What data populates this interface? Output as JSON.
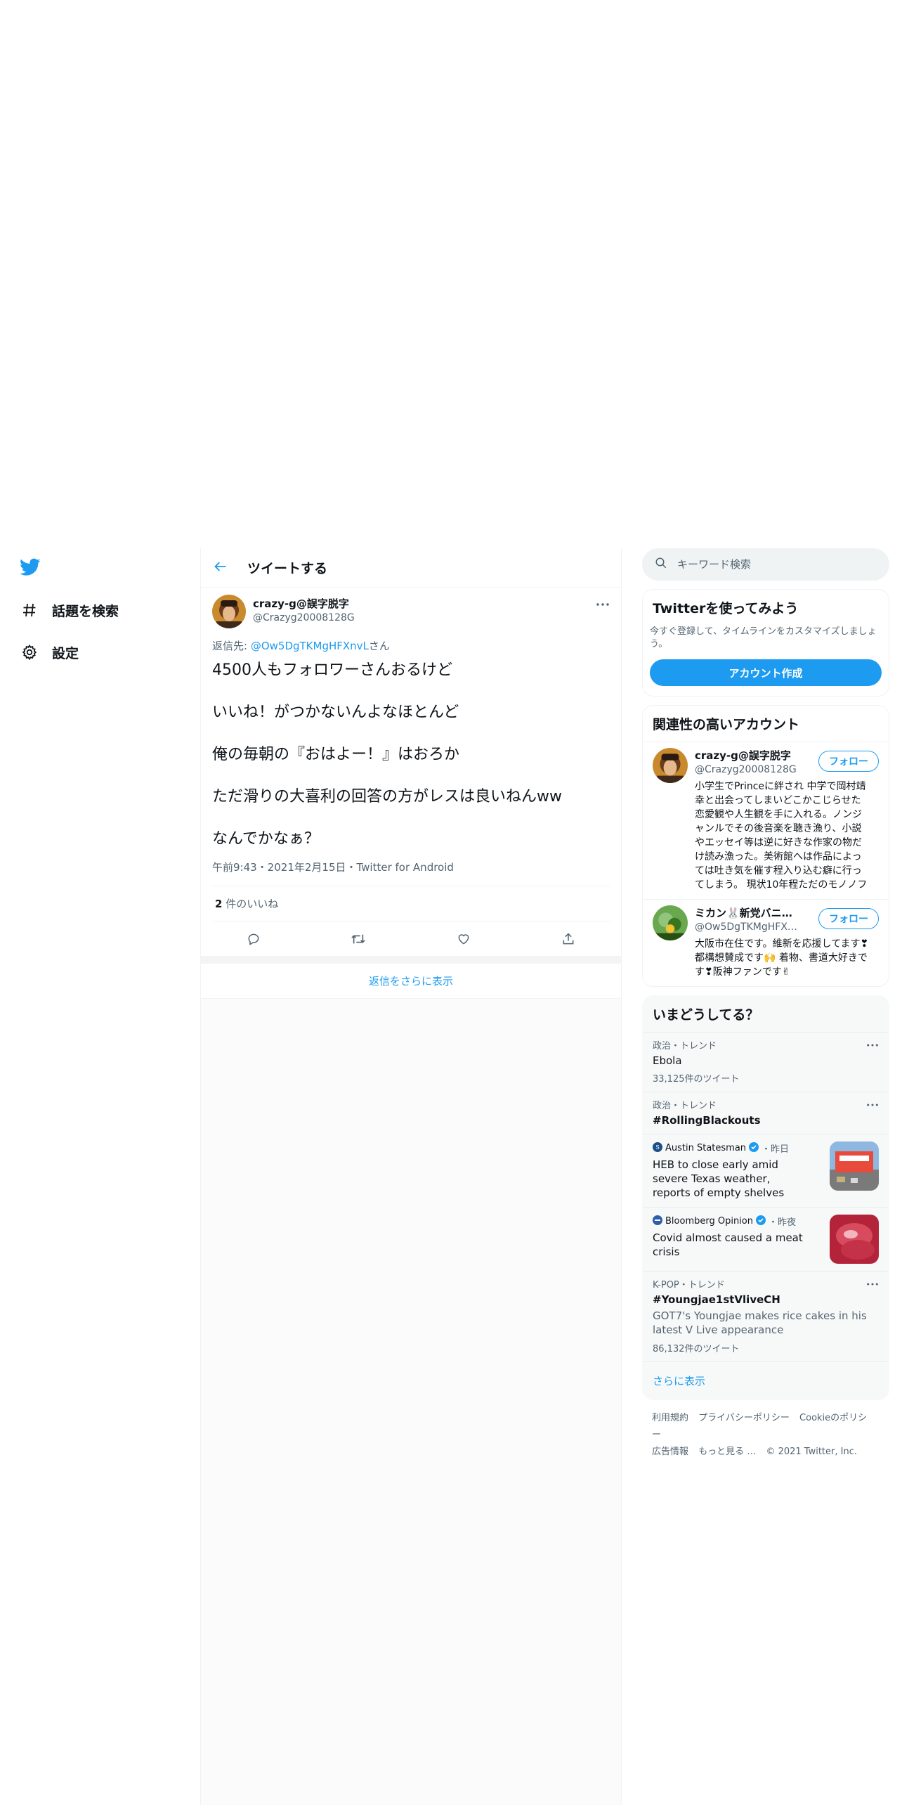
{
  "nav": {
    "logo": "twitter-bird-icon",
    "items": [
      {
        "icon": "hashtag-icon",
        "label": "話題を検索"
      },
      {
        "icon": "gear-icon",
        "label": "設定"
      }
    ]
  },
  "center": {
    "header_title": "ツイートする",
    "tweet": {
      "name": "crazy-g@誤字脱字",
      "handle": "@Crazyg20008128G",
      "reply_prefix": "返信先: ",
      "reply_link": "@Ow5DgTKMgHFXnvL",
      "reply_suffix": "さん",
      "lines": [
        "4500人もフォロワーさんおるけど",
        "いいね！がつかないんよなほとんど",
        "俺の毎朝の『おはよー！』はおろか",
        "ただ滑りの大喜利の回答の方がレスは良いねんww",
        "なんでかなぁ？"
      ],
      "meta": "午前9:43・2021年2月15日・Twitter for Android",
      "likes_count": "2",
      "likes_label": " 件のいいね"
    },
    "more_replies": "返信をさらに表示"
  },
  "right": {
    "search_placeholder": "キーワード検索",
    "signup": {
      "title": "Twitterを使ってみよう",
      "text": "今すぐ登録して、タイムラインをカスタマイズしましょう。",
      "button": "アカウント作成"
    },
    "related": {
      "title": "関連性の高いアカウント",
      "follow_label": "フォロー",
      "accounts": [
        {
          "name": "crazy-g@誤字脱字",
          "handle": "@Crazyg20008128G",
          "bio": "小学生でPrinceに絆され 中学で岡村靖幸と出会ってしまいどこかこじらせた恋愛観や人生観を手に入れる。ノンジャンルでその後音楽を聴き漁り、小説やエッセイ等は逆に好きな作家の物だけ読み漁った。美術館へは作品によっては吐き気を催す程入り込む癖に行ってしまう。 現状10年程ただのモノノフ"
        },
        {
          "name": "ミカン🐰新党バニー…",
          "handle": "@Ow5DgTKMgHFX…",
          "bio": "大阪市在住です。維新を応援してます❣都構想賛成です🙌 着物、書道大好きです❣阪神ファンです✌"
        }
      ]
    },
    "trends": {
      "title": "いまどうしてる？",
      "items": [
        {
          "category": "政治・トレンド",
          "name": "Ebola",
          "count": "33,125件のツイート"
        },
        {
          "category": "政治・トレンド",
          "name": "#RollingBlackouts"
        }
      ],
      "news": [
        {
          "source": "Austin Statesman",
          "when": "・昨日",
          "title": "HEB to close early amid severe Texas weather, reports of empty shelves"
        },
        {
          "source": "Bloomberg Opinion",
          "when": "・昨夜",
          "title": "Covid almost caused a meat crisis"
        }
      ],
      "kpop": {
        "category": "K-POP・トレンド",
        "name": "#Youngjae1stVliveCH",
        "desc": "GOT7's Youngjae makes rice cakes in his latest V Live appearance",
        "count": "86,132件のツイート"
      },
      "show_more": "さらに表示"
    },
    "footer": {
      "links": [
        "利用規約",
        "プライバシーポリシー",
        "Cookieのポリシー",
        "広告情報",
        "もっと見る …",
        "© 2021 Twitter, Inc."
      ]
    }
  },
  "colors": {
    "accent": "#1d9bf0",
    "text": "#0f1419",
    "secondary": "#536471"
  }
}
